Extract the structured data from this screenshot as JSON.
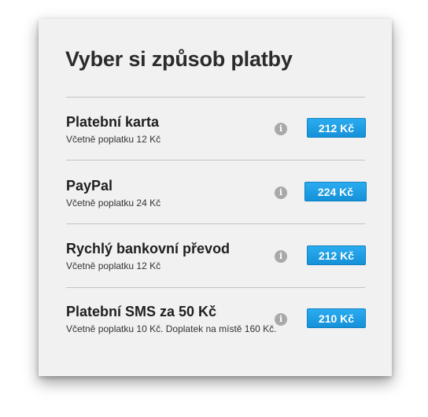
{
  "title": "Vyber si způsob platby",
  "info_icon_glyph": "i",
  "colors": {
    "button": "#1a9be3",
    "panel_bg": "#f1f1f1",
    "info_icon": "#a9a9a9"
  },
  "options": [
    {
      "name": "Platební karta",
      "note": "Včetně poplatku 12 Kč",
      "price": "212 Kč",
      "icon": "info-icon"
    },
    {
      "name": "PayPal",
      "note": "Včetně poplatku 24 Kč",
      "price": "224 Kč",
      "icon": "info-icon"
    },
    {
      "name": "Rychlý bankovní převod",
      "note": "Včetně poplatku 12 Kč",
      "price": "212 Kč",
      "icon": "info-icon"
    },
    {
      "name": "Platební SMS za 50 Kč",
      "note": "Včetně poplatku 10 Kč. Doplatek na místě 160 Kč.",
      "price": "210 Kč",
      "icon": "info-icon"
    }
  ]
}
